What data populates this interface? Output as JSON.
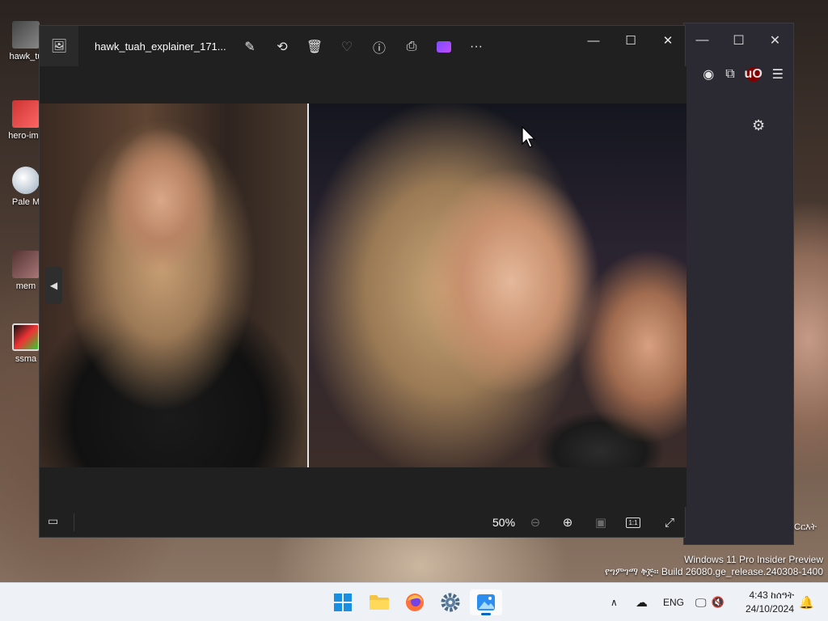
{
  "desktop": {
    "icons": [
      {
        "label": "hawk_tu",
        "icon": "image-file-icon"
      },
      {
        "label": "hero-ima",
        "icon": "image-file-icon"
      },
      {
        "label": "Pale M",
        "icon": "browser-shortcut-icon"
      },
      {
        "label": "mem",
        "icon": "image-file-icon"
      },
      {
        "label": "ssma",
        "icon": "app-shortcut-icon"
      }
    ],
    "watermark_line1": "Windows 11 Pro Insider Preview",
    "watermark_line2": "የግምገማ ቅጅ። Build 26080.ge_release.240308-1400",
    "side_label": "Cርእት"
  },
  "browser": {
    "window_controls": [
      "—",
      "☐",
      "✕"
    ]
  },
  "photos": {
    "file_title": "hawk_tuah_explainer_171...",
    "toolbar": [
      {
        "name": "edit-image-button",
        "icon": "✎"
      },
      {
        "name": "rotate-button",
        "icon": "⟲"
      },
      {
        "name": "delete-button",
        "icon": "🗑"
      },
      {
        "name": "favorite-button",
        "icon": "♡"
      },
      {
        "name": "file-info-button",
        "icon": "ⓘ"
      },
      {
        "name": "print-button",
        "icon": "⎙"
      },
      {
        "name": "clipchamp-button",
        "icon": "clip"
      },
      {
        "name": "more-options-button",
        "icon": "···"
      }
    ],
    "window_controls": [
      "—",
      "☐",
      "✕"
    ],
    "zoom": "50%"
  },
  "taskbar": {
    "language": "ENG",
    "time": "4:43 ከሰዓት",
    "date": "24/10/2024"
  }
}
